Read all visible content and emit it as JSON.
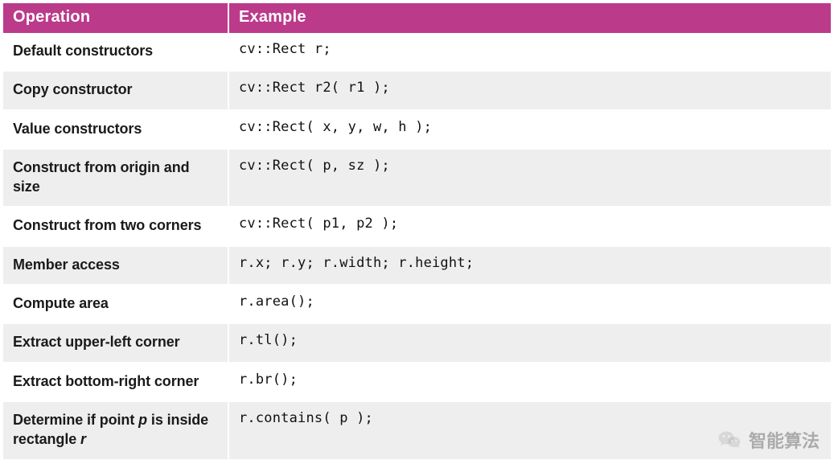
{
  "table": {
    "headers": {
      "operation": "Operation",
      "example": "Example"
    },
    "rows": [
      {
        "operation": "Default constructors",
        "example": "cv::Rect r;"
      },
      {
        "operation": "Copy constructor",
        "example": "cv::Rect r2( r1 );"
      },
      {
        "operation": "Value constructors",
        "example": "cv::Rect( x, y, w, h );"
      },
      {
        "operation": "Construct from origin and size",
        "example": "cv::Rect( p, sz );"
      },
      {
        "operation": "Construct from two corners",
        "example": "cv::Rect( p1, p2 );"
      },
      {
        "operation": "Member access",
        "example": "r.x; r.y; r.width; r.height;"
      },
      {
        "operation": "Compute area",
        "example": "r.area();"
      },
      {
        "operation": "Extract upper-left corner",
        "example": "r.tl();"
      },
      {
        "operation": "Extract bottom-right corner",
        "example": "r.br();"
      },
      {
        "operation_html": "Determine if point <span class=\"var\">p</span> is inside rectangle <span class=\"var\">r</span>",
        "operation": "Determine if point p is inside rectangle r",
        "example": "r.contains( p );"
      }
    ]
  },
  "watermark": {
    "text": "智能算法"
  },
  "colors": {
    "header_bg": "#bb3a8a",
    "row_alt": "#eeeeee"
  }
}
